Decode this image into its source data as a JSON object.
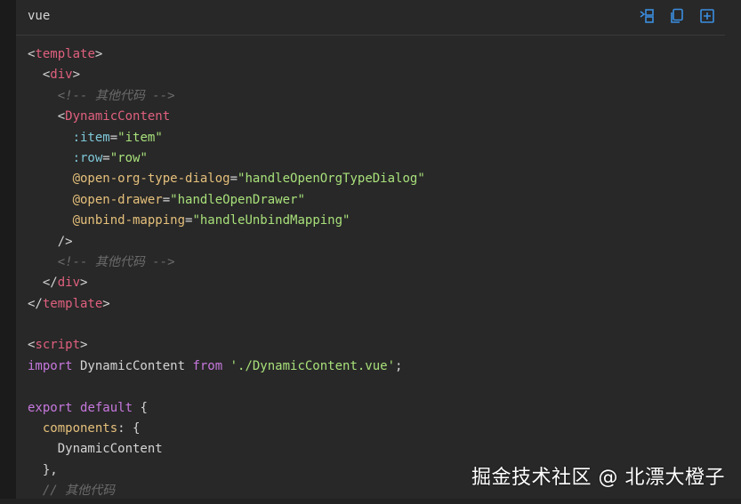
{
  "header": {
    "language": "vue",
    "actions": [
      {
        "name": "toggle-lines",
        "icon": "wrap-lines-icon"
      },
      {
        "name": "copy",
        "icon": "copy-icon"
      },
      {
        "name": "expand",
        "icon": "expand-icon"
      }
    ]
  },
  "code": {
    "lines": [
      [
        {
          "t": "punct",
          "v": "<"
        },
        {
          "t": "tag",
          "v": "template"
        },
        {
          "t": "punct",
          "v": ">"
        }
      ],
      [
        {
          "t": "plain",
          "v": "  "
        },
        {
          "t": "punct",
          "v": "<"
        },
        {
          "t": "tag",
          "v": "div"
        },
        {
          "t": "punct",
          "v": ">"
        }
      ],
      [
        {
          "t": "plain",
          "v": "    "
        },
        {
          "t": "comment",
          "v": "<!-- 其他代码 -->"
        }
      ],
      [
        {
          "t": "plain",
          "v": "    "
        },
        {
          "t": "punct",
          "v": "<"
        },
        {
          "t": "tag",
          "v": "DynamicContent"
        }
      ],
      [
        {
          "t": "plain",
          "v": "      "
        },
        {
          "t": "attr",
          "v": ":item"
        },
        {
          "t": "punct",
          "v": "="
        },
        {
          "t": "str",
          "v": "\"item\""
        }
      ],
      [
        {
          "t": "plain",
          "v": "      "
        },
        {
          "t": "attr",
          "v": ":row"
        },
        {
          "t": "punct",
          "v": "="
        },
        {
          "t": "str",
          "v": "\"row\""
        }
      ],
      [
        {
          "t": "plain",
          "v": "      "
        },
        {
          "t": "event",
          "v": "@open-org-type-dialog"
        },
        {
          "t": "punct",
          "v": "="
        },
        {
          "t": "str",
          "v": "\"handleOpenOrgTypeDialog\""
        }
      ],
      [
        {
          "t": "plain",
          "v": "      "
        },
        {
          "t": "event",
          "v": "@open-drawer"
        },
        {
          "t": "punct",
          "v": "="
        },
        {
          "t": "str",
          "v": "\"handleOpenDrawer\""
        }
      ],
      [
        {
          "t": "plain",
          "v": "      "
        },
        {
          "t": "event",
          "v": "@unbind-mapping"
        },
        {
          "t": "punct",
          "v": "="
        },
        {
          "t": "str",
          "v": "\"handleUnbindMapping\""
        }
      ],
      [
        {
          "t": "plain",
          "v": "    "
        },
        {
          "t": "punct",
          "v": "/>"
        }
      ],
      [
        {
          "t": "plain",
          "v": "    "
        },
        {
          "t": "comment",
          "v": "<!-- 其他代码 -->"
        }
      ],
      [
        {
          "t": "plain",
          "v": "  "
        },
        {
          "t": "punct",
          "v": "</"
        },
        {
          "t": "tag",
          "v": "div"
        },
        {
          "t": "punct",
          "v": ">"
        }
      ],
      [
        {
          "t": "punct",
          "v": "</"
        },
        {
          "t": "tag",
          "v": "template"
        },
        {
          "t": "punct",
          "v": ">"
        }
      ],
      [],
      [
        {
          "t": "punct",
          "v": "<"
        },
        {
          "t": "tag",
          "v": "script"
        },
        {
          "t": "punct",
          "v": ">"
        }
      ],
      [
        {
          "t": "kw",
          "v": "import"
        },
        {
          "t": "plain",
          "v": " DynamicContent "
        },
        {
          "t": "kw",
          "v": "from"
        },
        {
          "t": "plain",
          "v": " "
        },
        {
          "t": "str",
          "v": "'./DynamicContent.vue'"
        },
        {
          "t": "plain",
          "v": ";"
        }
      ],
      [],
      [
        {
          "t": "kw",
          "v": "export"
        },
        {
          "t": "plain",
          "v": " "
        },
        {
          "t": "kw",
          "v": "default"
        },
        {
          "t": "plain",
          "v": " {"
        }
      ],
      [
        {
          "t": "plain",
          "v": "  "
        },
        {
          "t": "key",
          "v": "components"
        },
        {
          "t": "plain",
          "v": ": {"
        }
      ],
      [
        {
          "t": "plain",
          "v": "    DynamicContent"
        }
      ],
      [
        {
          "t": "plain",
          "v": "  },"
        }
      ],
      [
        {
          "t": "plain",
          "v": "  "
        },
        {
          "t": "comment",
          "v": "// 其他代码"
        }
      ]
    ]
  },
  "watermark": "掘金技术社区 @ 北漂大橙子",
  "colors": {
    "background": "#282828",
    "tag": "#e0607e",
    "attr": "#7fc8d8",
    "event": "#e5c07b",
    "string": "#a8e07a",
    "keyword": "#c678dd",
    "comment": "#6b6b6b",
    "icon": "#3b8ee0"
  }
}
